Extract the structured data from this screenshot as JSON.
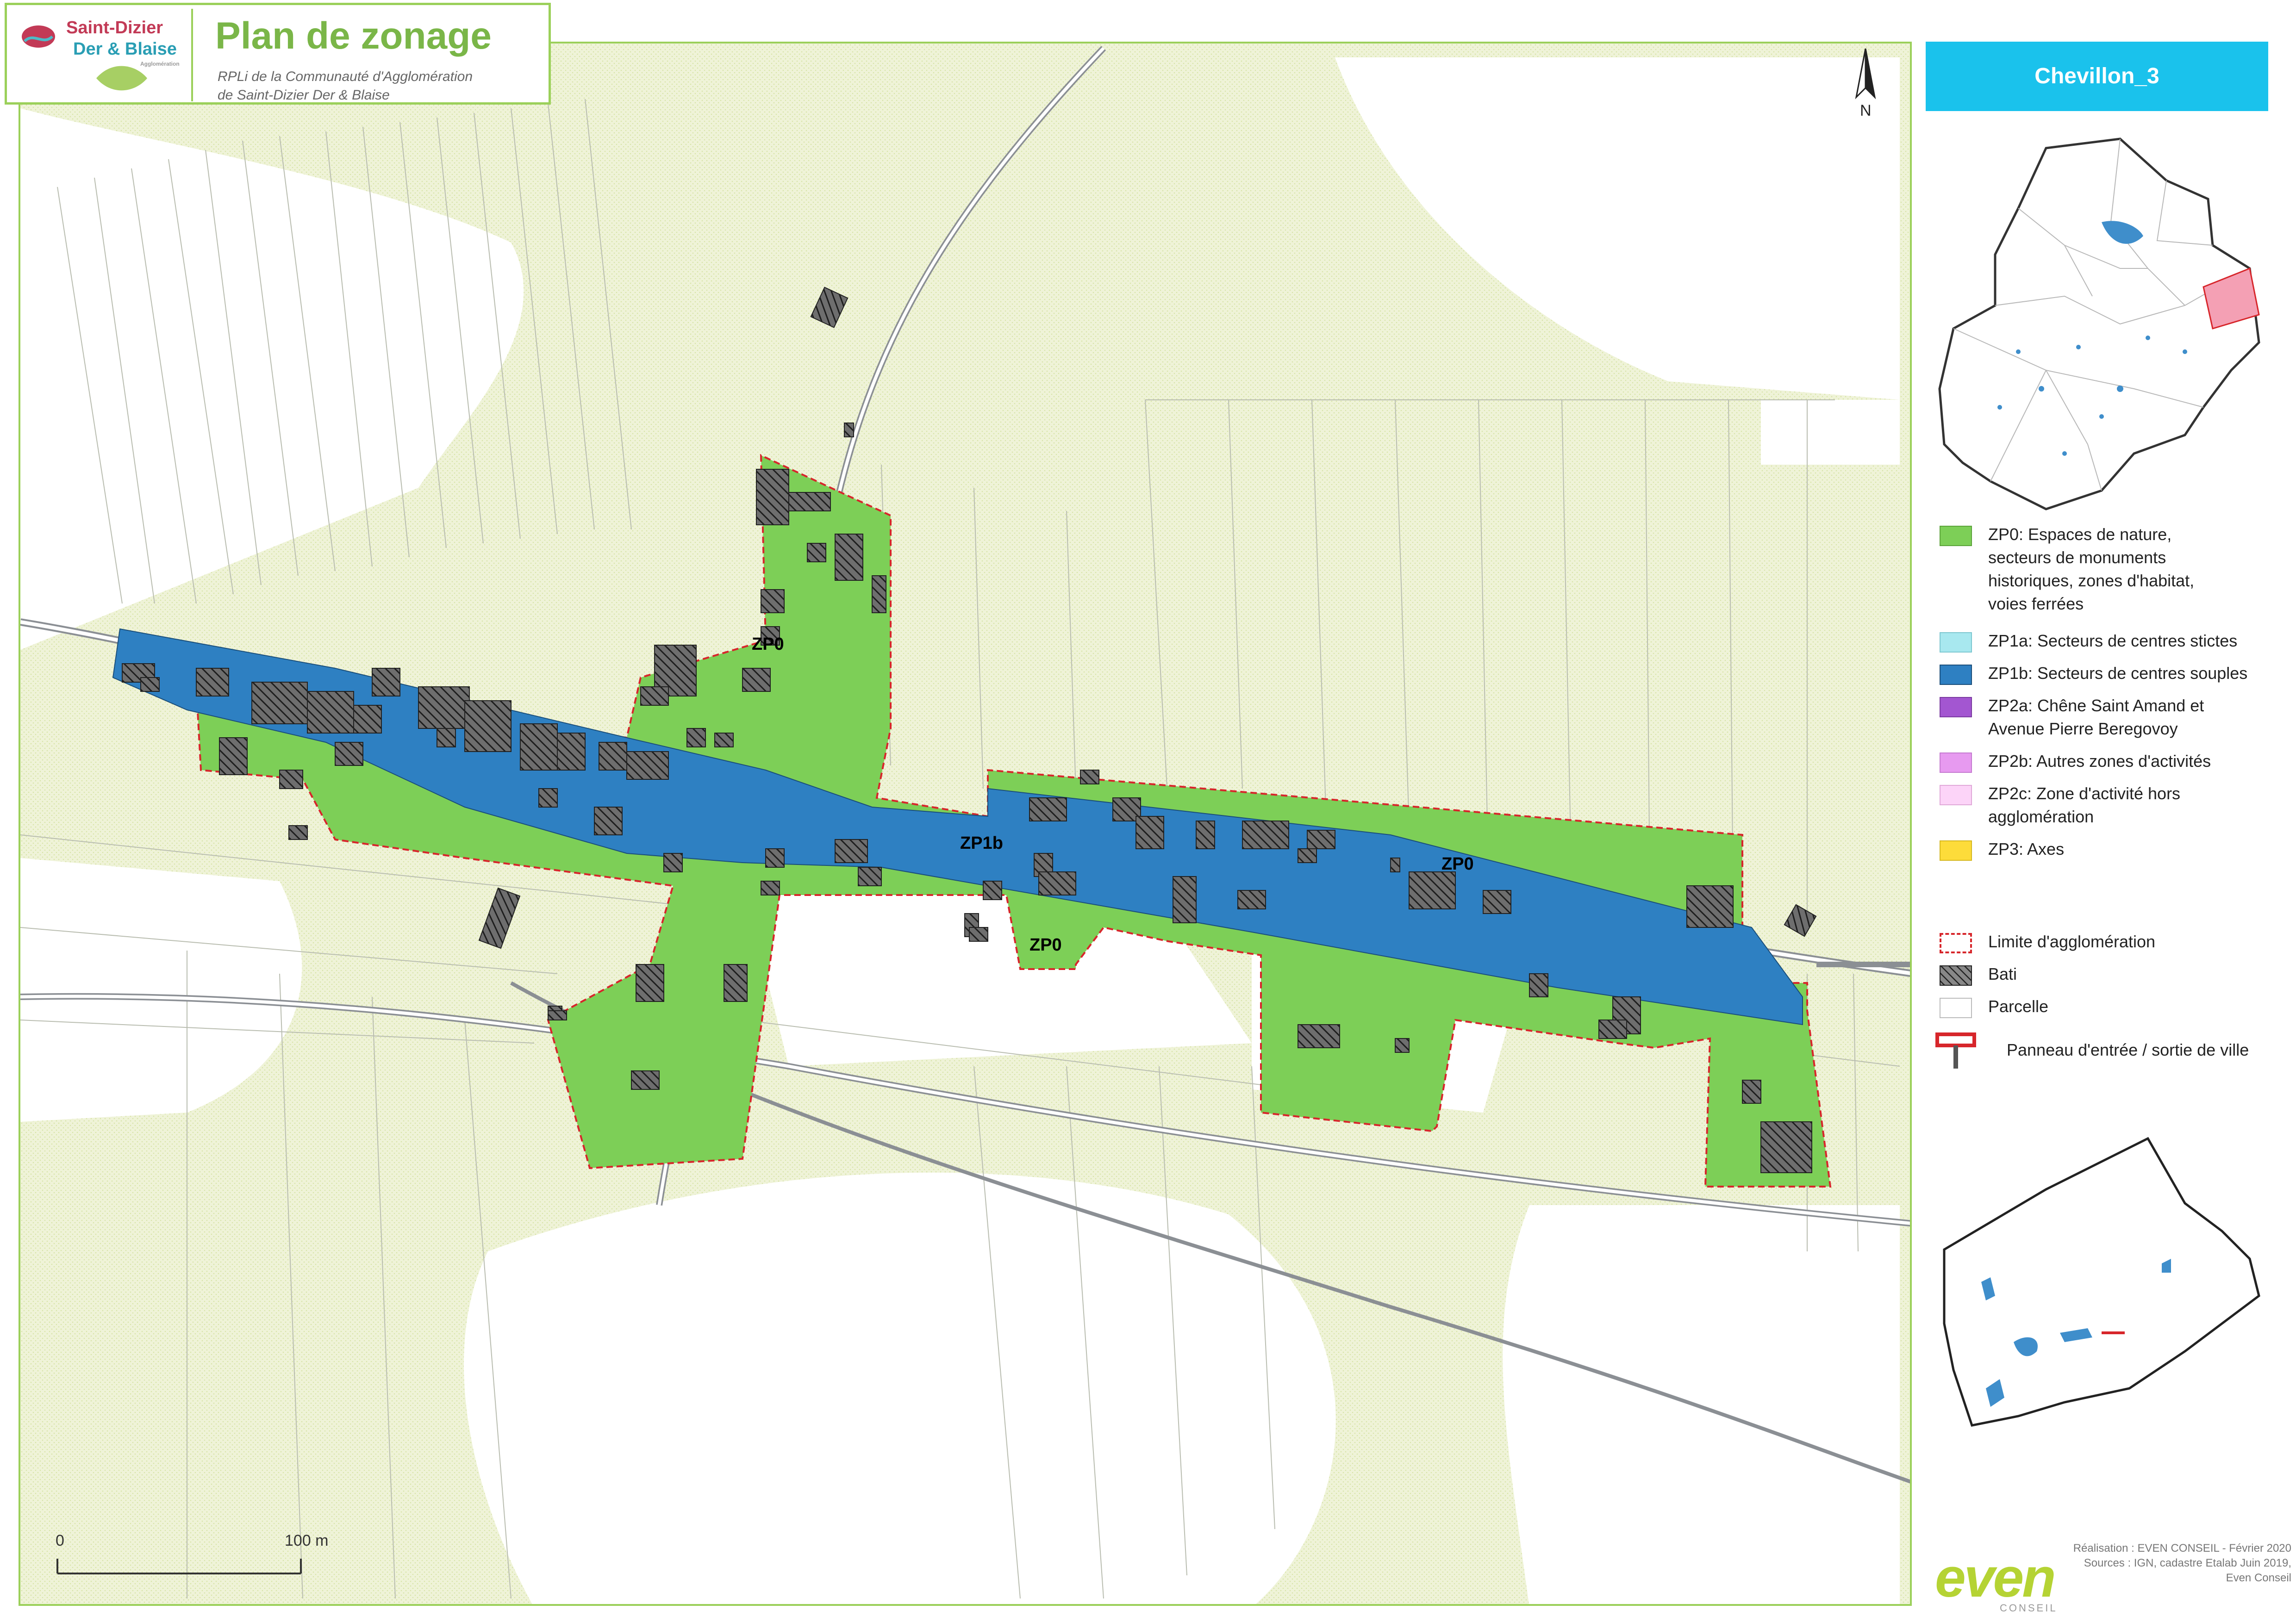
{
  "header": {
    "title": "Plan de zonage",
    "subtitle_line1": "RPLi de la Communauté d'Agglomération",
    "subtitle_line2": "de Saint-Dizier Der & Blaise",
    "logo_line1": "Saint-Dizier",
    "logo_line2": "Der & Blaise",
    "logo_line3": "Agglomération"
  },
  "north_arrow": {
    "label": "N"
  },
  "commune": {
    "name": "Chevillon_3"
  },
  "map_labels": {
    "zp0_north": "ZP0",
    "zp1b_center": "ZP1b",
    "zp0_south": "ZP0",
    "zp0_east": "ZP0"
  },
  "legend": {
    "items": [
      {
        "id": "zp0",
        "label": "ZP0: Espaces de nature,\nsecteurs de monuments\nhistoriques, zones d'habitat,\nvoies ferrées",
        "color": "#7dcf57",
        "icon": "fill-swatch"
      },
      {
        "id": "zp1a",
        "label": "ZP1a: Secteurs de centres stictes",
        "color": "#a8e8ef",
        "icon": "fill-swatch"
      },
      {
        "id": "zp1b",
        "label": "ZP1b: Secteurs de centres souples",
        "color": "#2e80c2",
        "icon": "fill-swatch"
      },
      {
        "id": "zp2a",
        "label": "ZP2a: Chêne Saint Amand et\nAvenue Pierre Beregovoy",
        "color": "#a356d1",
        "icon": "fill-swatch"
      },
      {
        "id": "zp2b",
        "label": "ZP2b: Autres zones d'activités",
        "color": "#e79af0",
        "icon": "fill-swatch"
      },
      {
        "id": "zp2c",
        "label": "ZP2c: Zone d'activité hors\nagglomération",
        "color": "#fcd4f8",
        "icon": "fill-swatch"
      },
      {
        "id": "zp3",
        "label": "ZP3: Axes",
        "color": "#fddc3a",
        "icon": "fill-swatch"
      }
    ],
    "symbols": [
      {
        "id": "limite",
        "label": "Limite d'agglomération",
        "icon": "dashed-red-outline"
      },
      {
        "id": "bati",
        "label": "Bati",
        "icon": "hatched-square"
      },
      {
        "id": "parcelle",
        "label": "Parcelle",
        "icon": "empty-square"
      },
      {
        "id": "panneau",
        "label": "Panneau d'entrée / sortie de ville",
        "icon": "red-sign-icon"
      }
    ]
  },
  "scale": {
    "start_label": "0",
    "end_label": "100 m"
  },
  "credits": {
    "line1": "Réalisation : EVEN CONSEIL - Février 2020",
    "line2": "Sources : IGN, cadastre Etalab Juin 2019,",
    "line3": "Even Conseil"
  },
  "even_logo": {
    "text": "even",
    "sub": "CONSEIL"
  },
  "colors": {
    "zp0_green": "#7dcf57",
    "zp1b_blue": "#2e80c2",
    "vegetation": "#eef3d6",
    "limit_red": "#d7262b",
    "frame_green": "#9bd05a",
    "commune_bar": "#1ac2ec"
  }
}
